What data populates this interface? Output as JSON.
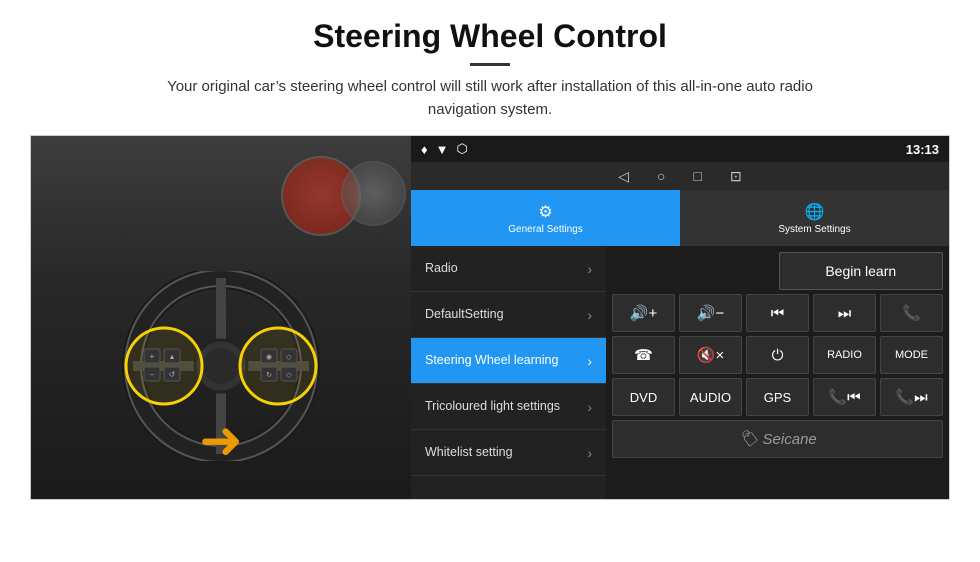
{
  "header": {
    "title": "Steering Wheel Control",
    "divider": true,
    "subtitle": "Your original car’s steering wheel control will still work after installation of this all-in-one auto radio navigation system."
  },
  "status_bar": {
    "time": "13:13",
    "icons": [
      "♦",
      "▼",
      "⬡"
    ]
  },
  "nav_bar": {
    "icons": [
      "◁",
      "○",
      "□",
      "⊡"
    ]
  },
  "tabs": [
    {
      "label": "General Settings",
      "icon": "⚙",
      "active": true
    },
    {
      "label": "System Settings",
      "icon": "🌐",
      "active": false
    }
  ],
  "menu_items": [
    {
      "label": "Radio",
      "active": false
    },
    {
      "label": "DefaultSetting",
      "active": false
    },
    {
      "label": "Steering Wheel learning",
      "active": true
    },
    {
      "label": "Tricoloured light settings",
      "active": false
    },
    {
      "label": "Whitelist setting",
      "active": false
    }
  ],
  "button_panel": {
    "begin_learn_label": "Begin learn",
    "rows": [
      [
        {
          "label": "🔊+",
          "icon": true
        },
        {
          "label": "🔊−",
          "icon": true
        },
        {
          "label": "⏮",
          "icon": true
        },
        {
          "label": "⏭",
          "icon": true
        },
        {
          "label": "📞",
          "icon": true
        }
      ],
      [
        {
          "label": "☎",
          "icon": true
        },
        {
          "label": "🔇×",
          "icon": true
        },
        {
          "label": "⏻",
          "icon": true
        },
        {
          "label": "RADIO",
          "icon": false
        },
        {
          "label": "MODE",
          "icon": false
        }
      ],
      [
        {
          "label": "DVD",
          "icon": false
        },
        {
          "label": "AUDIO",
          "icon": false
        },
        {
          "label": "GPS",
          "icon": false
        },
        {
          "label": "📞⏮",
          "icon": true
        },
        {
          "label": "📞⏭",
          "icon": true
        }
      ]
    ],
    "watermark": "Seicane"
  }
}
